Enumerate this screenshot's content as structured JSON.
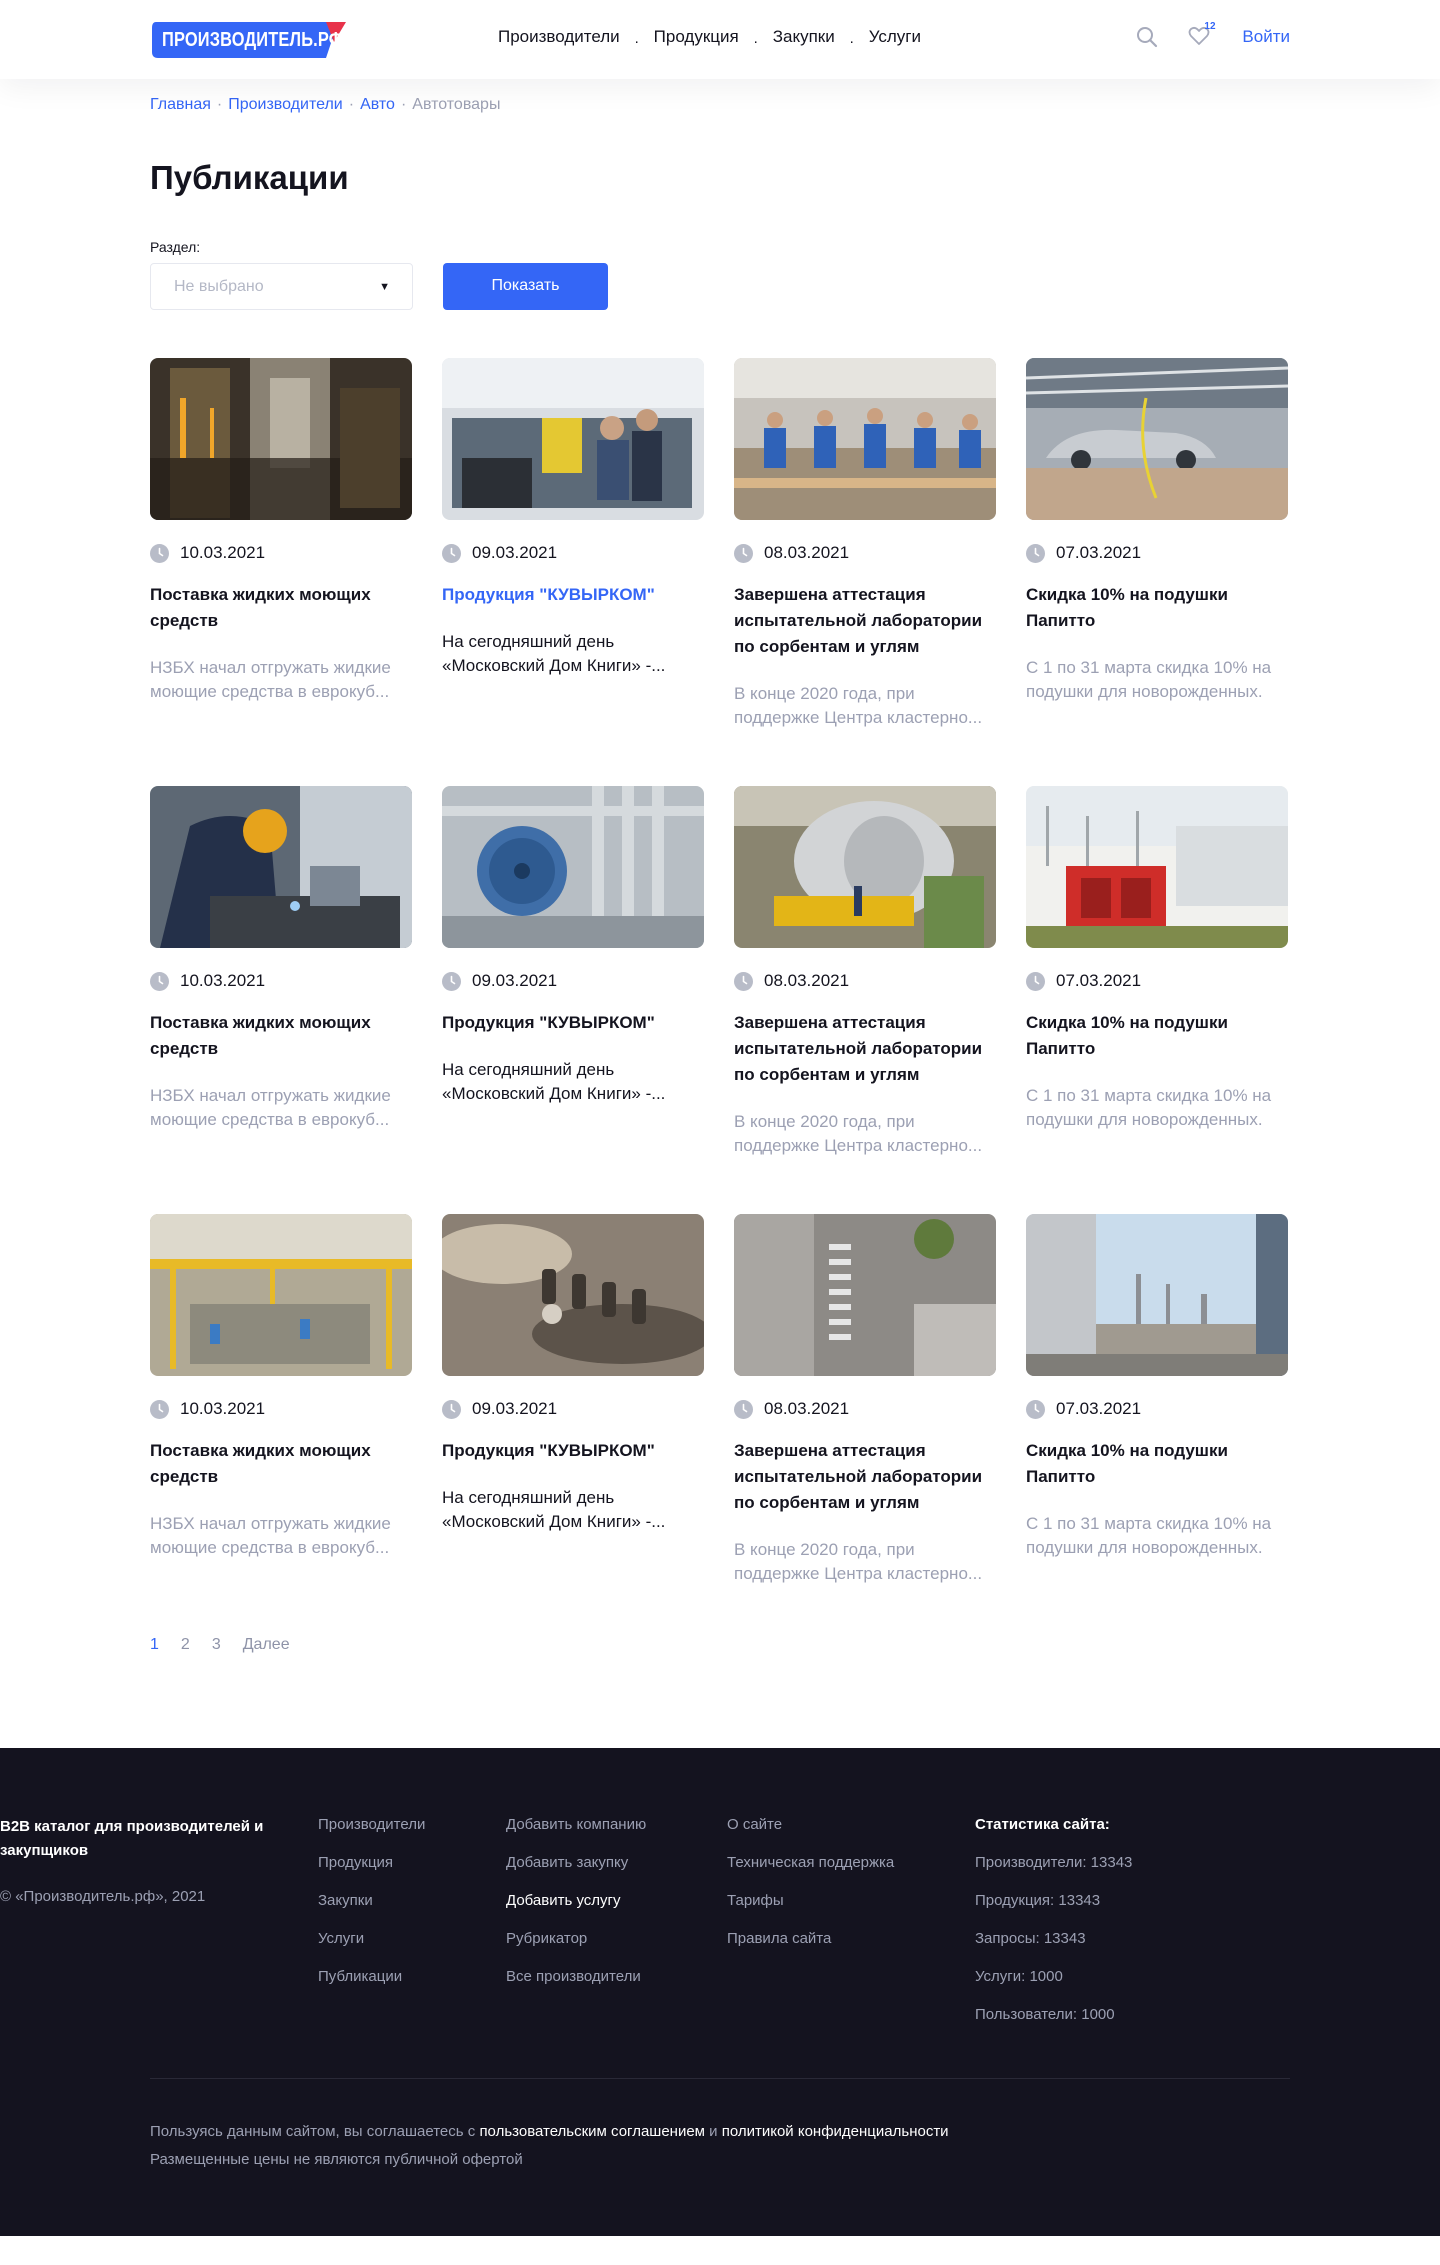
{
  "header": {
    "logo_text": "ПРОИЗВОДИТЕЛЬ.РФ",
    "nav": [
      "Производители",
      "Продукция",
      "Закупки",
      "Услуги"
    ],
    "favorites_count": "12",
    "login": "Войти",
    "accent": "#3466f6"
  },
  "breadcrumb": {
    "items": [
      "Главная",
      "Производители",
      "Авто"
    ],
    "current": "Автотовары",
    "sep": "·"
  },
  "page_title": "Публикации",
  "filter": {
    "label": "Раздел:",
    "select_placeholder": "Не выбрано",
    "button": "Показать"
  },
  "cards": [
    {
      "date": "10.03.2021",
      "title": "Поставка жидких моющих средств",
      "text": "НЗБХ начал отгружать жидкие моющие средства в еврокуб...",
      "image": "steel-mill"
    },
    {
      "date": "09.03.2021",
      "title": "Продукция \"КУВЫРКОМ\"",
      "text": "На сегодняшний день «Московский Дом Книги» -...",
      "image": "lab-workers",
      "highlight": true
    },
    {
      "date": "08.03.2021",
      "title": "Завершена аттестация испытательной лаборатории по сорбентам и углям",
      "text": "В конце 2020 года, при поддержке Центра кластерно...",
      "image": "assembly-line"
    },
    {
      "date": "07.03.2021",
      "title": "Скидка 10% на подушки Папитто",
      "text": "С 1 по 31 марта скидка 10% на подушки для новорожденных.",
      "image": "car-factory"
    },
    {
      "date": "10.03.2021",
      "title": "Поставка жидких моющих средств",
      "text": "НЗБХ начал отгружать жидкие моющие средства в еврокуб...",
      "image": "welder"
    },
    {
      "date": "09.03.2021",
      "title": "Продукция \"КУВЫРКОМ\"",
      "text": "На сегодняшний день «Московский Дом Книги» -...",
      "image": "pipes-fan"
    },
    {
      "date": "08.03.2021",
      "title": "Завершена аттестация испытательной лаборатории по сорбентам и углям",
      "text": "В конце 2020 года, при поддержке Центра кластерно...",
      "image": "turbine"
    },
    {
      "date": "07.03.2021",
      "title": "Скидка 10% на подушки Папитто",
      "text": "С 1 по 31 марта скидка 10% на подушки для новорожденных.",
      "image": "refinery-building"
    },
    {
      "date": "10.03.2021",
      "title": "Поставка жидких моющих средств",
      "text": "НЗБХ начал отгружать жидкие моющие средства в еврокуб...",
      "image": "factory-hall"
    },
    {
      "date": "09.03.2021",
      "title": "Продукция \"КУВЫРКОМ\"",
      "text": "На сегодняшний день «Московский Дом Книги» -...",
      "image": "bottling"
    },
    {
      "date": "08.03.2021",
      "title": "Завершена аттестация испытательной лаборатории по сорбентам и углям",
      "text": "В конце 2020 года, при поддержке Центра кластерно...",
      "image": "warehouse-aerial"
    },
    {
      "date": "07.03.2021",
      "title": "Скидка 10% на подушки Папитто",
      "text": "С 1 по 31 марта скидка 10% на подушки для новорожденных.",
      "image": "refinery-tanks"
    }
  ],
  "pagination": {
    "pages": [
      "1",
      "2",
      "3"
    ],
    "active": "1",
    "next": "Далее"
  },
  "footer": {
    "brand": "B2B каталог для производителей и закупщиков",
    "copyright": "© «Производитель.рф», 2021",
    "col1": [
      "Производители",
      "Продукция",
      "Закупки",
      "Услуги",
      "Публикации"
    ],
    "col2": [
      "Добавить компанию",
      "Добавить закупку",
      "Добавить услугу",
      "Рубрикатор",
      "Все производители"
    ],
    "col3": [
      "О сайте",
      "Техническая поддержка",
      "Тарифы",
      "Правила сайта"
    ],
    "stats_title": "Статистика сайта:",
    "stats": [
      "Производители: 13343",
      "Продукция: 13343",
      "Запросы: 13343",
      "Услуги: 1000",
      "Пользователи: 1000"
    ],
    "agreement_prefix": "Пользуясь данным сайтом, вы соглашаетесь с",
    "agreement_link1": "пользовательским соглашением",
    "agreement_and": "и",
    "agreement_link2": "политикой конфиденциальности",
    "prices_note": "Размещенные цены не являются публичной офертой"
  }
}
